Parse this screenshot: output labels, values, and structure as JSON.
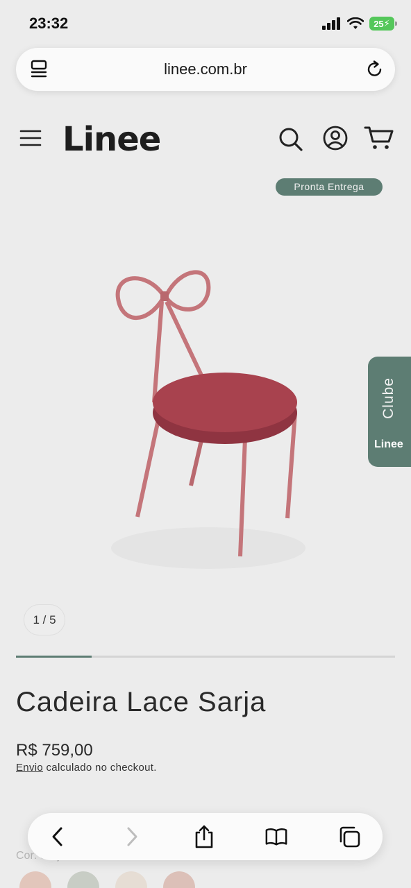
{
  "status_bar": {
    "time": "23:32",
    "battery": "25"
  },
  "browser": {
    "url": "linee.com.br"
  },
  "header": {
    "logo": "Linee"
  },
  "product": {
    "badge": "Pronta Entrega",
    "image_counter": "1 / 5",
    "gallery_progress": 0.2,
    "title": "Cadeira Lace Sarja",
    "price": "R$ 759,00",
    "shipping_link": "Envio",
    "shipping_text": " calculado no checkout.",
    "below_fold_label": "Cor: Sarja Terracota - Velvet"
  },
  "club_tab": {
    "label": "Clube",
    "logo": "Linee"
  },
  "colors": {
    "accent": "#5d7d73",
    "background": "#ececec",
    "chair_seat": "#a8424e",
    "chair_frame": "#c4757a"
  },
  "icons": {
    "menu": "hamburger-icon",
    "search": "search-icon",
    "account": "user-icon",
    "cart": "cart-icon",
    "reader": "reader-icon",
    "reload": "reload-icon",
    "back": "back-icon",
    "forward": "forward-icon",
    "share": "share-icon",
    "bookmarks": "bookmarks-icon",
    "tabs": "tabs-icon"
  }
}
